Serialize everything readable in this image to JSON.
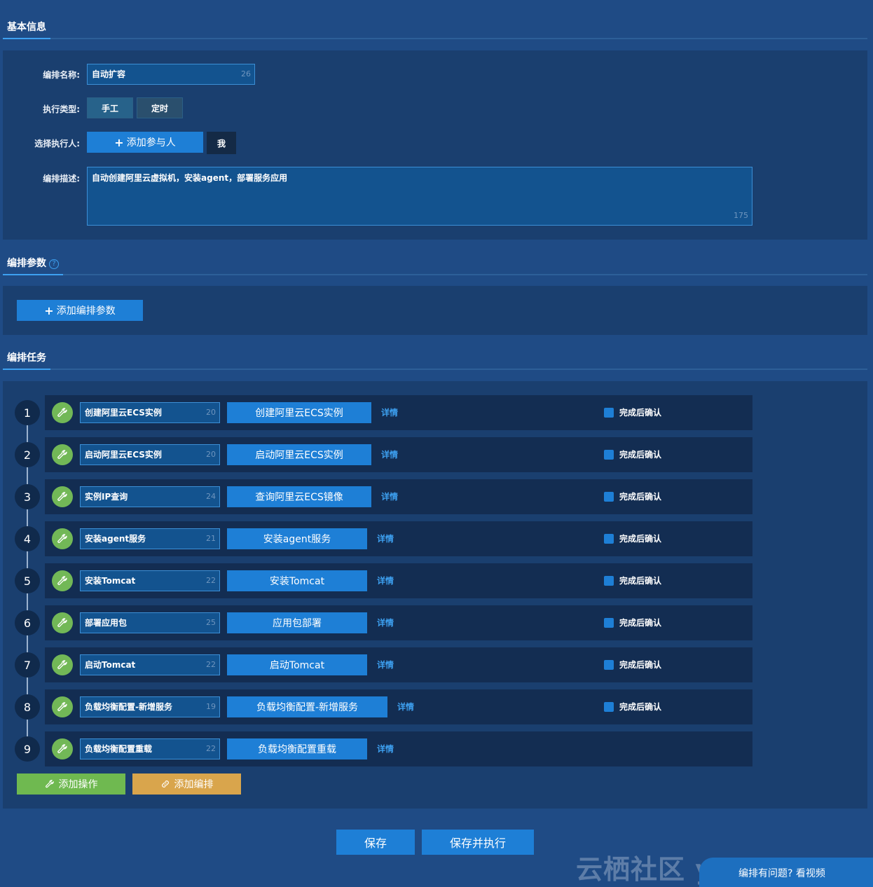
{
  "sections": {
    "basic": "基本信息",
    "params": "编排参数",
    "tasks": "编排任务"
  },
  "form": {
    "name_label": "编排名称:",
    "name_value": "自动扩容",
    "name_counter": "26",
    "type_label": "执行类型:",
    "type_manual": "手工",
    "type_scheduled": "定时",
    "executor_label": "选择执行人:",
    "add_participant": "添加参与人",
    "me_tag": "我",
    "desc_label": "编排描述:",
    "desc_value": "自动创建阿里云虚拟机，安装agent，部署服务应用",
    "desc_counter": "175"
  },
  "params": {
    "help": "?",
    "add_param": "添加编排参数"
  },
  "tasks": [
    {
      "num": "1",
      "name": "创建阿里云ECS实例",
      "counter": "20",
      "action": "创建阿里云ECS实例",
      "detail": "详情",
      "confirm": "完成后确认"
    },
    {
      "num": "2",
      "name": "启动阿里云ECS实例",
      "counter": "20",
      "action": "启动阿里云ECS实例",
      "detail": "详情",
      "confirm": "完成后确认"
    },
    {
      "num": "3",
      "name": "实例IP查询",
      "counter": "24",
      "action": "查询阿里云ECS镜像",
      "detail": "详情",
      "confirm": "完成后确认"
    },
    {
      "num": "4",
      "name": "安装agent服务",
      "counter": "21",
      "action": "安装agent服务",
      "detail": "详情",
      "confirm": "完成后确认"
    },
    {
      "num": "5",
      "name": "安装Tomcat",
      "counter": "22",
      "action": "安装Tomcat",
      "detail": "详情",
      "confirm": "完成后确认"
    },
    {
      "num": "6",
      "name": "部署应用包",
      "counter": "25",
      "action": "应用包部署",
      "detail": "详情",
      "confirm": "完成后确认"
    },
    {
      "num": "7",
      "name": "启动Tomcat",
      "counter": "22",
      "action": "启动Tomcat",
      "detail": "详情",
      "confirm": "完成后确认"
    },
    {
      "num": "8",
      "name": "负载均衡配置-新增服务",
      "counter": "19",
      "action": "负载均衡配置-新增服务",
      "detail": "详情",
      "confirm": "完成后确认"
    },
    {
      "num": "9",
      "name": "负载均衡配置重载",
      "counter": "22",
      "action": "负载均衡配置重载",
      "detail": "详情"
    }
  ],
  "task_buttons": {
    "add_operation": "添加操作",
    "add_orchestration": "添加编排"
  },
  "footer": {
    "save": "保存",
    "save_run": "保存并执行",
    "help_text": "编排有问题? 看视频",
    "watermark": "云栖社区 yq.aliyun.com"
  },
  "colors": {
    "background": "#1f4b85",
    "panel": "#1a3f6f",
    "primary": "#1e7fd6",
    "green": "#6fb950",
    "orange": "#d9a54c"
  }
}
